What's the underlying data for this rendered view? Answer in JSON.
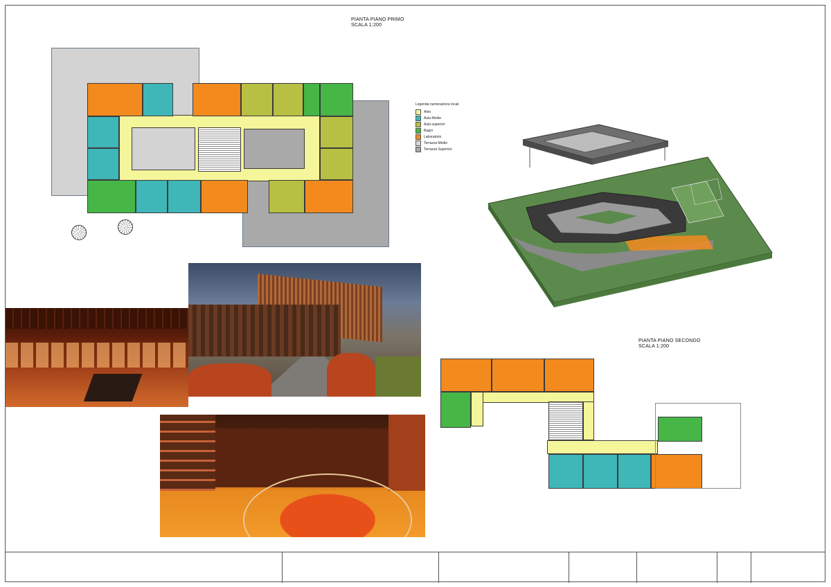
{
  "plan1": {
    "title": "PIANTA PIANO PRIMO",
    "scale": "SCALA 1:200"
  },
  "plan2": {
    "title": "PIANTA PIANO SECONDO",
    "scale": "SCALA 1:200"
  },
  "legend": {
    "title": "Legenda numerazione locali",
    "items": [
      {
        "label": "Atrio",
        "color": "#f5f59a"
      },
      {
        "label": "Aula Medie",
        "color": "#3fb6b8"
      },
      {
        "label": "Aula superiori",
        "color": "#b8c043"
      },
      {
        "label": "Bagni",
        "color": "#46b647"
      },
      {
        "label": "Laboratorio",
        "color": "#f28a1e"
      },
      {
        "label": "Terrazza Medie",
        "color": "#d9d9d9"
      },
      {
        "label": "Terrazza Superiori",
        "color": "#a8a8a8"
      }
    ]
  },
  "colors": {
    "atrio": "#f5f59a",
    "aula_medie": "#3fb6b8",
    "aula_superiori": "#b8c043",
    "bagni": "#46b647",
    "laboratorio": "#f28a1e",
    "terrazza_medie": "#d9d9d9",
    "terrazza_superiori": "#a8a8a8"
  }
}
